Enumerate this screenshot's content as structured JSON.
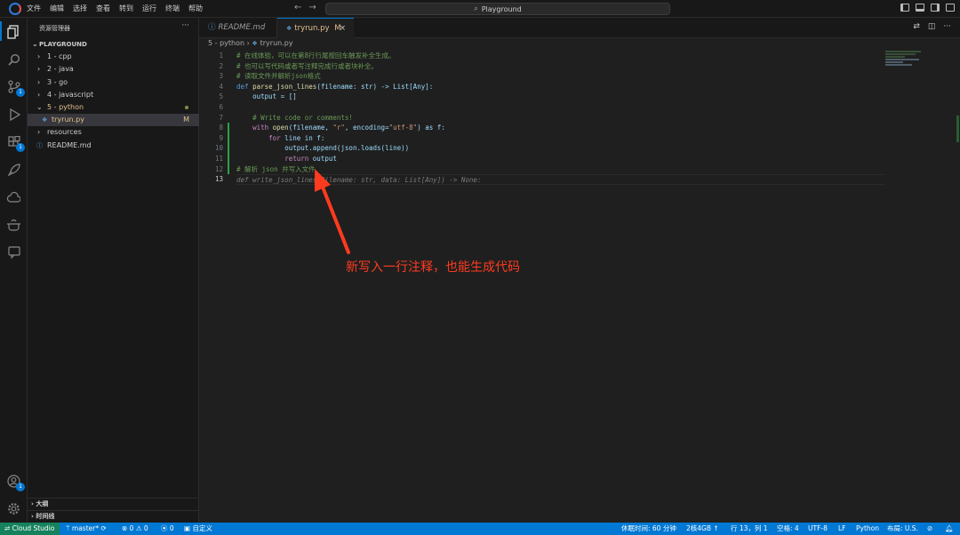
{
  "titlebar": {
    "menus": [
      "文件",
      "编辑",
      "选择",
      "查看",
      "转到",
      "运行",
      "终端",
      "帮助"
    ],
    "search_text": "Playground"
  },
  "sidebar": {
    "title": "资源管理器",
    "more": "···",
    "root_label": "PLAYGROUND",
    "items": [
      {
        "label": "1 - cpp"
      },
      {
        "label": "2 - java"
      },
      {
        "label": "3 - go"
      },
      {
        "label": "4 - javascript"
      },
      {
        "label": "5 - python"
      },
      {
        "label": "tryrun.py",
        "badge": "M"
      },
      {
        "label": "resources"
      },
      {
        "label": "README.md"
      }
    ],
    "outline_label": "大纲",
    "timeline_label": "时间线"
  },
  "activity_badges": {
    "scm": "1",
    "extensions": "1",
    "accounts": "1"
  },
  "tabs": [
    {
      "label": "README.md"
    },
    {
      "label": "tryrun.py",
      "status": "M"
    }
  ],
  "breadcrumb": {
    "folder": "5 - python",
    "file": "tryrun.py"
  },
  "editor": {
    "line_numbers": [
      "1",
      "2",
      "3",
      "4",
      "5",
      "6",
      "7",
      "8",
      "9",
      "10",
      "11",
      "12",
      "13"
    ],
    "lines": {
      "l1": "# 在线体验，可以在第8行行尾按回车触发补全生成。",
      "l2": "# 也可以写代码或者写注释完成行或者块补全。",
      "l3": "# 读取文件并解析json格式",
      "l4_def": "def",
      "l4_name": "parse_json_lines",
      "l4_rest": "(filename: str) -> List[Any]:",
      "l5": "output = []",
      "l7": "# Write code or comments!",
      "l8_with": "with",
      "l8_open": "open",
      "l8_args": "(filename, ",
      "l8_mode": "\"r\"",
      "l8_enc": ", encoding=",
      "l8_utf": "\"utf-8\"",
      "l8_as": ") as f:",
      "l9_for": "for",
      "l9_rest": " line in f:",
      "l10": "output.append(json.loads(line))",
      "l11_ret": "return",
      "l11_rest": " output",
      "l12": "# 解析 json 并写入文件",
      "l13_ghost": "def write_json_lines(filename: str, data: List[Any]) -> None:"
    }
  },
  "annotation": {
    "text": "新写入一行注释，也能生成代码",
    "color": "#ff3b1f"
  },
  "statusbar": {
    "remote": "Cloud Studio",
    "branch": "master*",
    "problems": "0 ⚠ 0",
    "ports": "0",
    "custom": "自定义",
    "rest_time": "休眠时间: 60 分钟",
    "machine": "2核4GB ↑",
    "position": "行 13，列 1",
    "spaces": "空格: 4",
    "encoding": "UTF-8",
    "eol": "LF",
    "language": "Python",
    "layout": "布局: U.S."
  },
  "colors": {
    "accent": "#0078d4",
    "remote": "#16825d",
    "modified": "#e2c08d"
  }
}
